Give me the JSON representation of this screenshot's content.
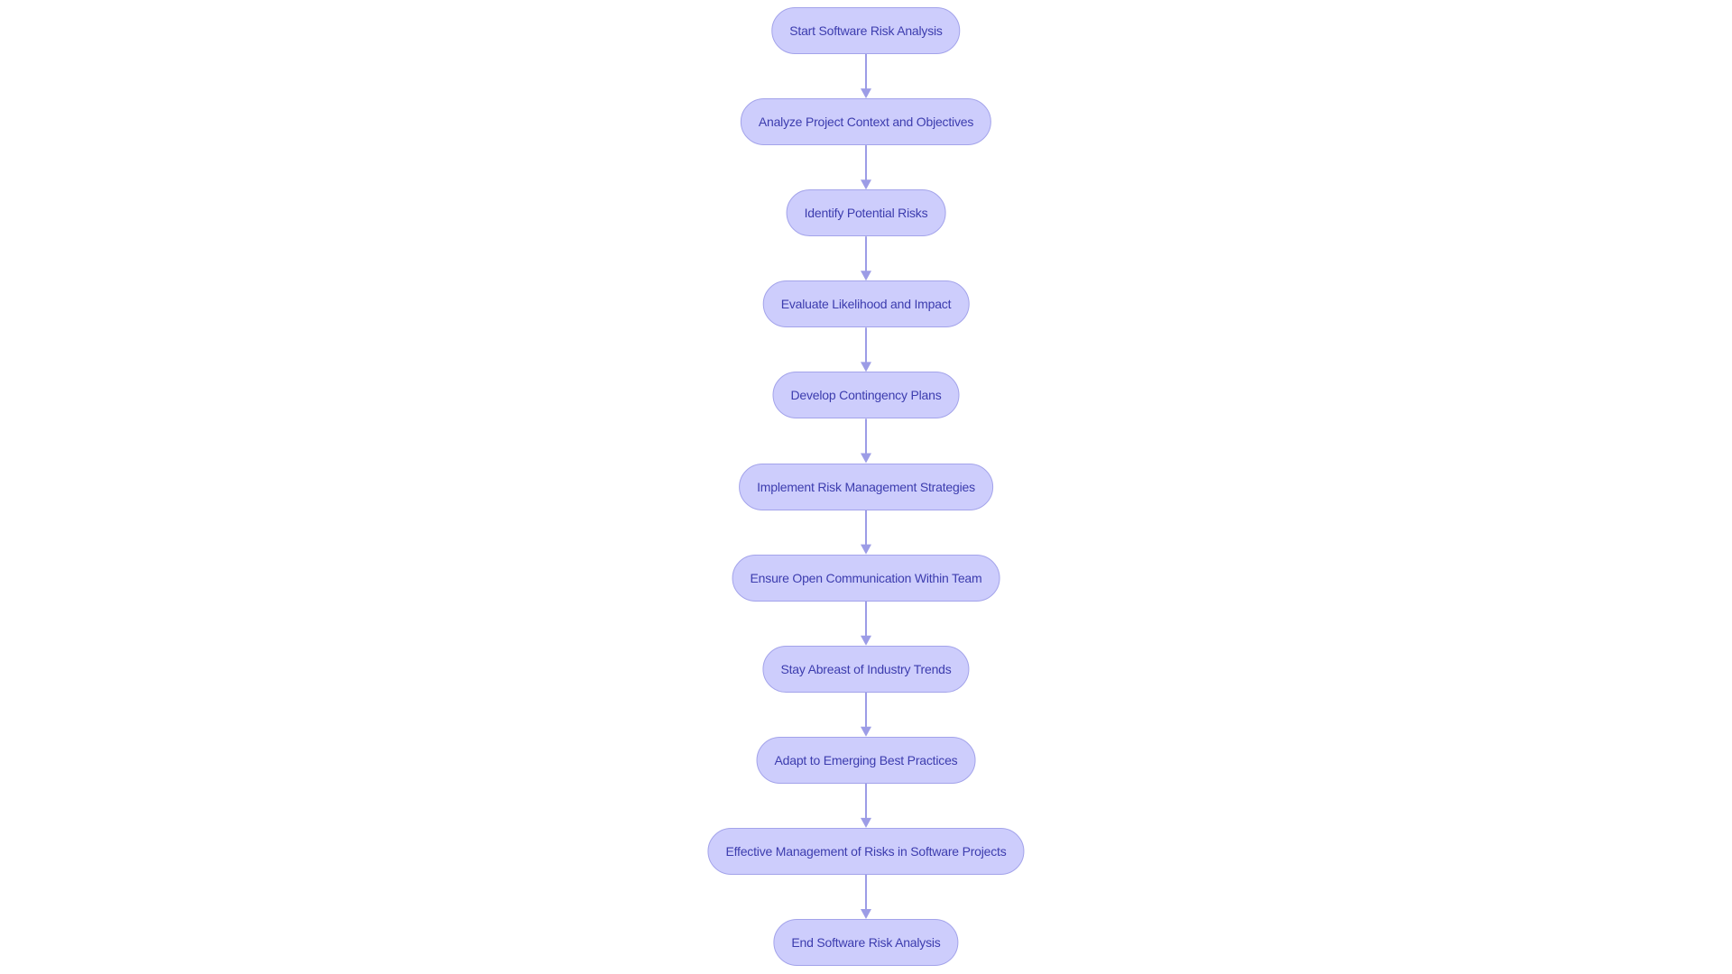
{
  "diagram": {
    "type": "flowchart",
    "direction": "top-to-bottom",
    "colors": {
      "node_fill": "#cdcdfc",
      "node_border": "#a3a3ea",
      "text": "#3c3cae",
      "edge": "#9c9ce6"
    },
    "nodes": [
      {
        "id": "n1",
        "label": "Start Software Risk Analysis"
      },
      {
        "id": "n2",
        "label": "Analyze Project Context and Objectives"
      },
      {
        "id": "n3",
        "label": "Identify Potential Risks"
      },
      {
        "id": "n4",
        "label": "Evaluate Likelihood and Impact"
      },
      {
        "id": "n5",
        "label": "Develop Contingency Plans"
      },
      {
        "id": "n6",
        "label": "Implement Risk Management Strategies"
      },
      {
        "id": "n7",
        "label": "Ensure Open Communication Within Team"
      },
      {
        "id": "n8",
        "label": "Stay Abreast of Industry Trends"
      },
      {
        "id": "n9",
        "label": "Adapt to Emerging Best Practices"
      },
      {
        "id": "n10",
        "label": "Effective Management of Risks in Software Projects"
      },
      {
        "id": "n11",
        "label": "End Software Risk Analysis"
      }
    ],
    "edges": [
      [
        "n1",
        "n2"
      ],
      [
        "n2",
        "n3"
      ],
      [
        "n3",
        "n4"
      ],
      [
        "n4",
        "n5"
      ],
      [
        "n5",
        "n6"
      ],
      [
        "n6",
        "n7"
      ],
      [
        "n7",
        "n8"
      ],
      [
        "n8",
        "n9"
      ],
      [
        "n9",
        "n10"
      ],
      [
        "n10",
        "n11"
      ]
    ]
  }
}
